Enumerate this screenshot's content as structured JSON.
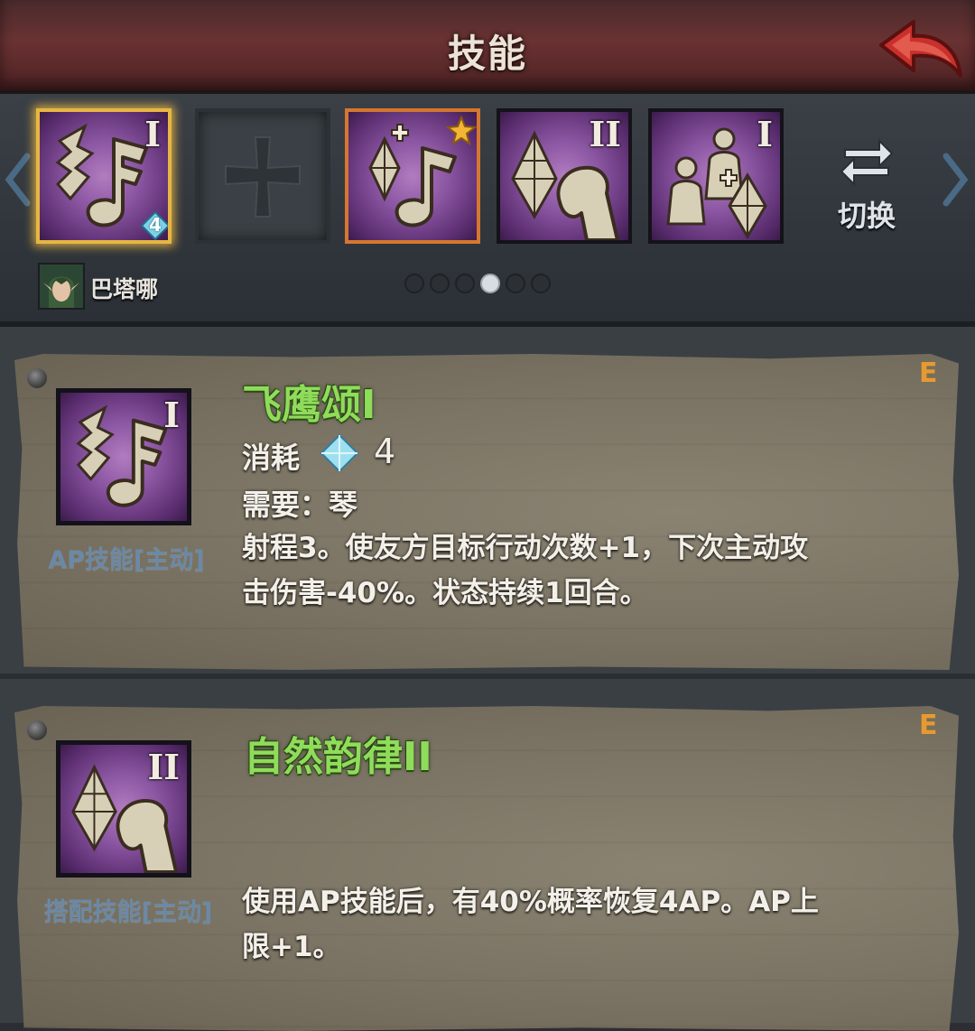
{
  "header": {
    "title": "技能"
  },
  "skill_strip": {
    "slots": [
      {
        "roman": "I",
        "badge": "4",
        "selected": true
      },
      {
        "empty": true
      },
      {
        "roman": "",
        "starred": true
      },
      {
        "roman": "II"
      },
      {
        "roman": "I"
      }
    ],
    "switch_label": "切换"
  },
  "hero": {
    "name": "巴塔哪"
  },
  "page_dots": {
    "count": 6,
    "active_index": 3
  },
  "details": [
    {
      "rank": "E",
      "roman": "I",
      "name": "飞鹰颂I",
      "skill_type": "AP技能[主动]",
      "cost_label": "消耗",
      "cost_value": "4",
      "requirement": "需要：琴",
      "description_line1": "射程3。使友方目标行动次数+1，下次主动攻",
      "description_line2": "击伤害-40%。状态持续1回合。"
    },
    {
      "rank": "E",
      "roman": "II",
      "name": "自然韵律II",
      "skill_type": "搭配技能[主动]",
      "description_line1": "使用AP技能后，有40%概率恢复4AP。AP上",
      "description_line2": "限+1。"
    }
  ],
  "colors": {
    "skill_name": "#8fdc5a",
    "rank": "#e79a2f",
    "skill_type": "#6b89a6",
    "icon_purple": "#8a55a1",
    "selected_border": "#e7b643"
  }
}
